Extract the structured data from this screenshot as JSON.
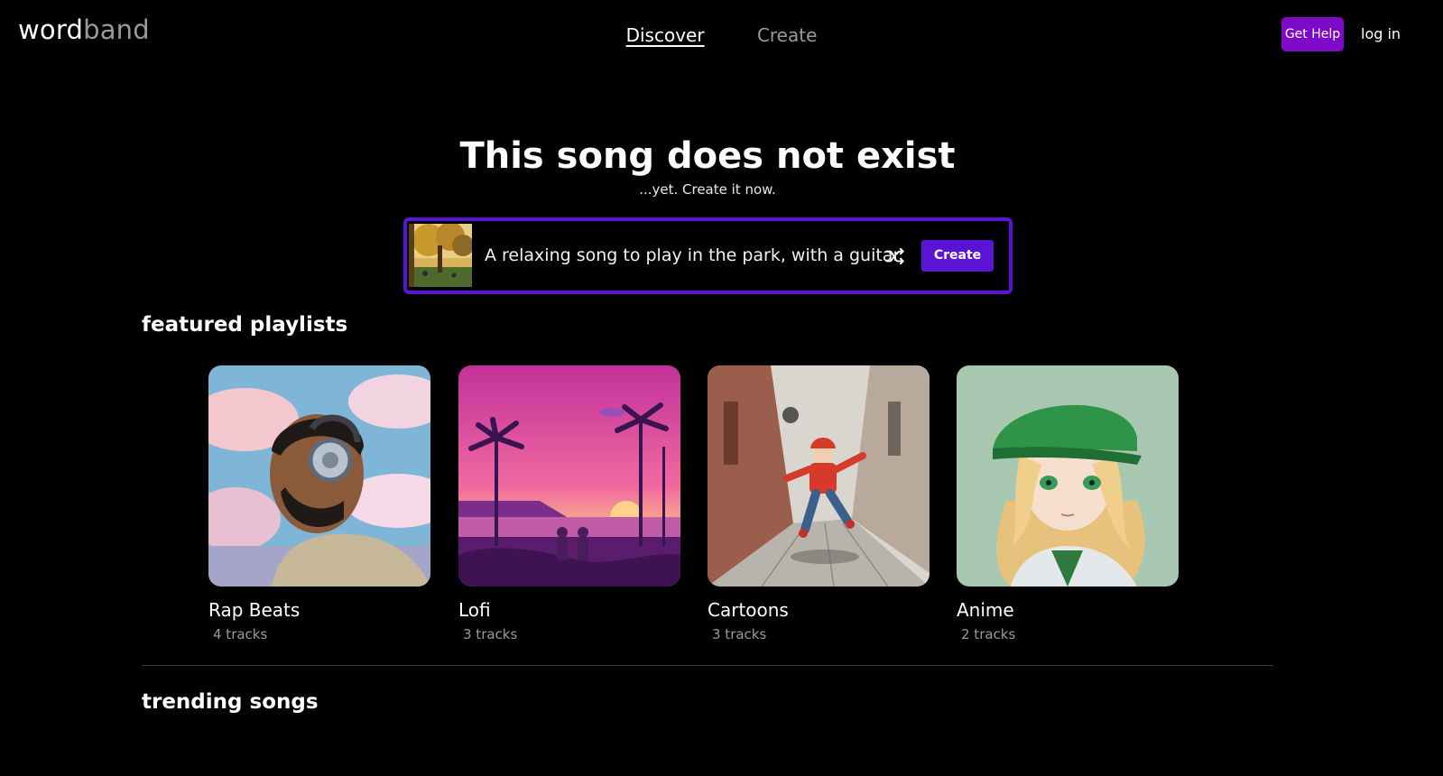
{
  "header": {
    "logo_part1": "word",
    "logo_part2": "band",
    "nav": [
      {
        "label": "Discover",
        "active": true
      },
      {
        "label": "Create",
        "active": false
      }
    ],
    "help_label": "Get Help",
    "login_label": "log in"
  },
  "hero": {
    "title": "This song does not exist",
    "subtitle": "...yet. Create it now."
  },
  "prompt": {
    "text": "A relaxing song to play in the park, with a guitar",
    "shuffle_icon": "shuffle-icon",
    "create_label": "Create",
    "accent_color": "#5b14d6"
  },
  "featured": {
    "title": "featured playlists",
    "playlists": [
      {
        "name": "Rap Beats",
        "count": "4 tracks"
      },
      {
        "name": "Lofi",
        "count": "3 tracks"
      },
      {
        "name": "Cartoons",
        "count": "3 tracks"
      },
      {
        "name": "Anime",
        "count": "2 tracks"
      }
    ]
  },
  "trending": {
    "title": "trending songs"
  },
  "colors": {
    "background": "#000000",
    "help_button": "#7e09c9",
    "muted_text": "#9a9a9a"
  }
}
